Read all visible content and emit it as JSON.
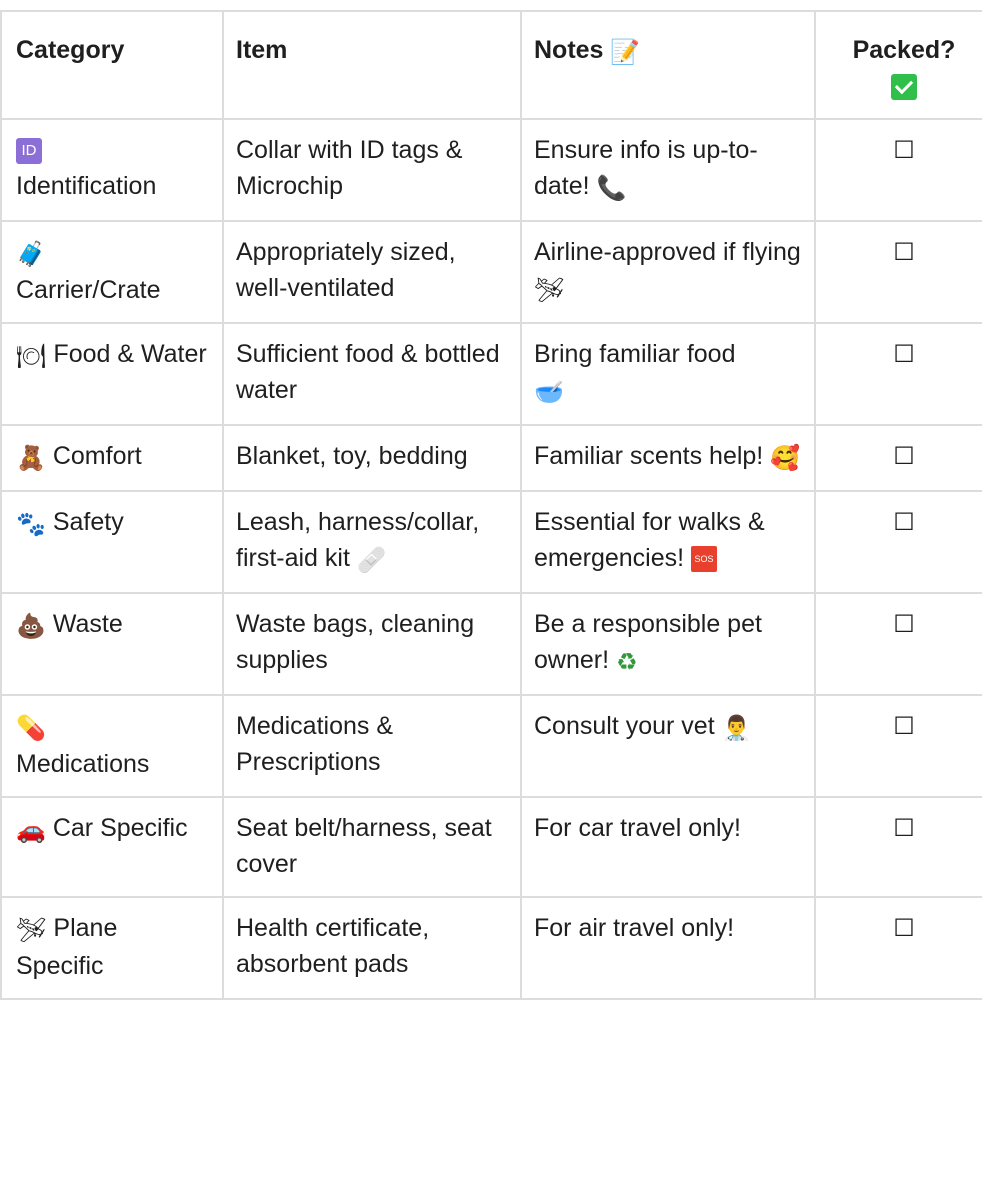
{
  "headers": {
    "category": "Category",
    "item": "Item",
    "notes": "Notes",
    "notes_icon": "📝",
    "packed": "Packed?",
    "packed_icon": "check-mark-button"
  },
  "checkbox_symbol": "☐",
  "rows": [
    {
      "category_icon": "id-button",
      "category_icon_text": "ID",
      "category": "Identification",
      "item": "Collar with ID tags & Microchip",
      "notes": "Ensure info is up-to-date!",
      "notes_icon": "📞"
    },
    {
      "category_icon": "luggage",
      "category_icon_glyph": "🧳",
      "category": "Carrier/Crate",
      "item": "Appropriately sized, well-ventilated",
      "notes": "Airline-approved if flying",
      "notes_icon": "🛩"
    },
    {
      "category_icon": "fork-and-knife-with-plate",
      "category_icon_glyph": "🍽",
      "category": "Food & Water",
      "item": "Sufficient food & bottled water",
      "notes": "Bring familiar food",
      "notes_icon": "🥣"
    },
    {
      "category_icon": "teddy-bear",
      "category_icon_glyph": "🧸",
      "category": "Comfort",
      "item": "Blanket, toy, bedding",
      "notes": "Familiar scents help!",
      "notes_icon": "🥰"
    },
    {
      "category_icon": "paw-prints",
      "category_icon_glyph": "🐾",
      "category": "Safety",
      "item": "Leash, harness/collar, first-aid kit",
      "item_icon": "🩹",
      "notes": "Essential for walks & emergencies!",
      "notes_icon": "SOS"
    },
    {
      "category_icon": "pile-of-poo",
      "category_icon_glyph": "💩",
      "category": "Waste",
      "item": "Waste bags, cleaning supplies",
      "notes": "Be a responsible pet owner!",
      "notes_icon": "♻"
    },
    {
      "category_icon": "pill",
      "category_icon_glyph": "💊",
      "category": "Medications",
      "item": "Medications & Prescriptions",
      "notes": "Consult your vet",
      "notes_icon": "👨‍⚕️"
    },
    {
      "category_icon": "automobile",
      "category_icon_glyph": "🚗",
      "category": "Car Specific",
      "item": "Seat belt/harness, seat cover",
      "notes": "For car travel only!"
    },
    {
      "category_icon": "small-airplane",
      "category_icon_glyph": "🛩",
      "category": "Plane Specific",
      "item": "Health certificate, absorbent pads",
      "notes": "For air travel only!"
    }
  ]
}
